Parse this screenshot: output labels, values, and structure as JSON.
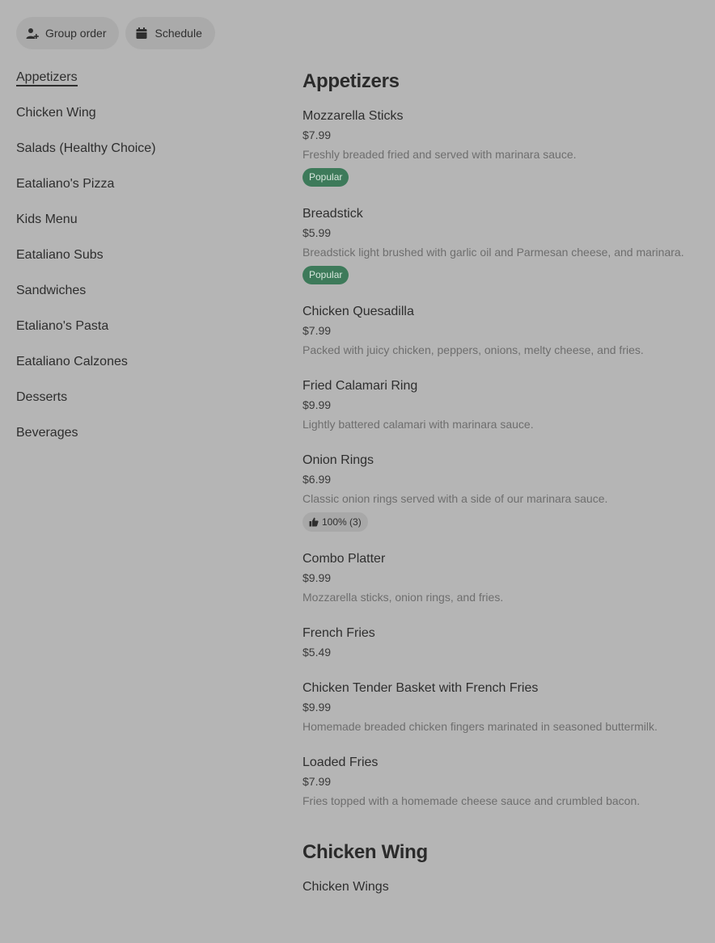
{
  "topbar": {
    "group_order": "Group order",
    "schedule": "Schedule"
  },
  "sidebar": {
    "items": [
      {
        "label": "Appetizers",
        "active": true
      },
      {
        "label": "Chicken Wing"
      },
      {
        "label": "Salads (Healthy Choice)"
      },
      {
        "label": "Eataliano's Pizza"
      },
      {
        "label": "Kids Menu"
      },
      {
        "label": "Eataliano Subs"
      },
      {
        "label": "Sandwiches"
      },
      {
        "label": "Etaliano's Pasta"
      },
      {
        "label": "Eataliano Calzones"
      },
      {
        "label": "Desserts"
      },
      {
        "label": "Beverages"
      }
    ]
  },
  "sections": [
    {
      "title": "Appetizers",
      "items": [
        {
          "name": "Mozzarella Sticks",
          "price": "$7.99",
          "desc": "Freshly breaded fried and served with marinara sauce.",
          "badge": "Popular"
        },
        {
          "name": "Breadstick",
          "price": "$5.99",
          "desc": "Breadstick light brushed with garlic oil and Parmesan cheese, and marinara.",
          "badge": "Popular"
        },
        {
          "name": "Chicken Quesadilla",
          "price": "$7.99",
          "desc": "Packed with juicy chicken, peppers, onions, melty cheese, and fries."
        },
        {
          "name": "Fried Calamari Ring",
          "price": "$9.99",
          "desc": "Lightly battered calamari with marinara sauce."
        },
        {
          "name": "Onion Rings",
          "price": "$6.99",
          "desc": "Classic onion rings served with a side of our marinara sauce.",
          "rating": "100% (3)"
        },
        {
          "name": "Combo Platter",
          "price": "$9.99",
          "desc": "Mozzarella sticks, onion rings, and fries."
        },
        {
          "name": "French Fries",
          "price": "$5.49"
        },
        {
          "name": "Chicken Tender Basket with French Fries",
          "price": "$9.99",
          "desc": "Homemade breaded chicken fingers marinated in seasoned buttermilk."
        },
        {
          "name": "Loaded Fries",
          "price": "$7.99",
          "desc": "Fries topped with a homemade cheese sauce and crumbled bacon."
        }
      ]
    },
    {
      "title": "Chicken Wing",
      "items": [
        {
          "name": "Chicken Wings"
        }
      ]
    }
  ],
  "colors": {
    "background": "#b5b5b5",
    "popular_badge": "#3d7a5a",
    "text": "#2e2e2e"
  },
  "icons": {
    "group_order": "person-add-icon",
    "schedule": "calendar-icon",
    "rating": "thumbs-up-icon"
  }
}
